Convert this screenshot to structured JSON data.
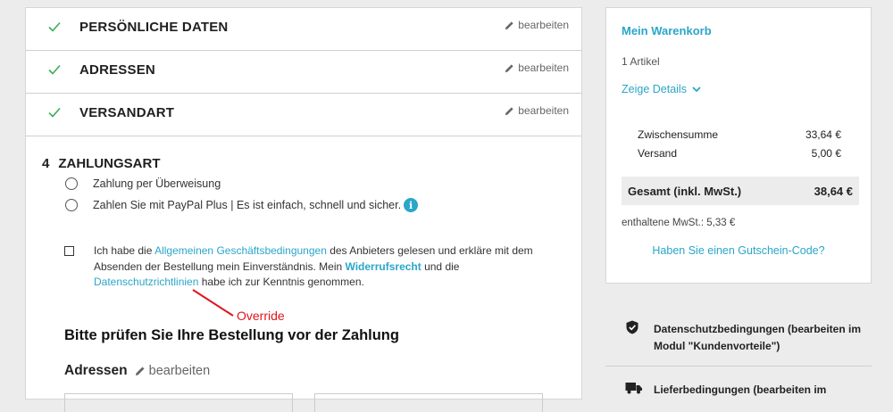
{
  "steps": [
    {
      "title": "PERSÖNLICHE DATEN",
      "edit_label": "bearbeiten"
    },
    {
      "title": "ADRESSEN",
      "edit_label": "bearbeiten"
    },
    {
      "title": "VERSANDART",
      "edit_label": "bearbeiten"
    }
  ],
  "payment": {
    "number": "4",
    "title": "ZAHLUNGSART",
    "options": [
      {
        "label": "Zahlung per Überweisung"
      },
      {
        "label": "Zahlen Sie mit PayPal Plus | Es ist einfach, schnell und sicher."
      }
    ],
    "info_icon_glyph": "i"
  },
  "agb": {
    "text_1": "Ich habe die ",
    "link_agb": "Allgemeinen Geschäftsbedingungen",
    "text_2": " des Anbieters gelesen und erkläre mit dem Absenden der Bestellung mein Einverständnis. Mein ",
    "link_widerruf": "Widerrufsrecht",
    "text_3": " und die ",
    "link_datenschutz": "Datenschutzrichtlinien",
    "text_4": " habe ich zur Kenntnis genommen."
  },
  "annotation": {
    "label": "Override",
    "color": "#e0141e"
  },
  "review": {
    "title": "Bitte prüfen Sie Ihre Bestellung vor der Zahlung",
    "addresses_label": "Adressen",
    "addresses_edit": "bearbeiten"
  },
  "cart": {
    "title": "Mein Warenkorb",
    "count": "1 Artikel",
    "details_label": "Zeige Details",
    "subtotal_label": "Zwischensumme",
    "subtotal_value": "33,64 €",
    "shipping_label": "Versand",
    "shipping_value": "5,00 €",
    "total_label": "Gesamt (inkl. MwSt.)",
    "total_value": "38,64 €",
    "tax_note": "enthaltene MwSt.: 5,33 €",
    "voucher_label": "Haben Sie einen Gutschein-Code?"
  },
  "features": [
    {
      "icon": "shield-check-icon",
      "text": "Datenschutzbedingungen (bearbeiten im Modul \"Kundenvorteile\")"
    },
    {
      "icon": "truck-icon",
      "text": "Lieferbedingungen (bearbeiten im"
    }
  ],
  "colors": {
    "accent": "#2aa6c9",
    "check": "#3cab52",
    "annotation": "#e0141e"
  }
}
